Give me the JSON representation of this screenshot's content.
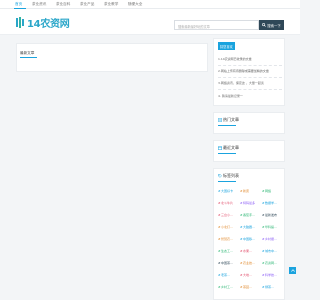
{
  "nav": {
    "items": [
      {
        "label": "首页",
        "active": true
      },
      {
        "label": "茶业资讯",
        "active": false
      },
      {
        "label": "茶业百科",
        "active": false
      },
      {
        "label": "茶业产品",
        "active": false
      },
      {
        "label": "茶业教学",
        "active": false
      },
      {
        "label": "随便大全",
        "active": false
      }
    ]
  },
  "header": {
    "logo_text": "14农资网",
    "search_placeholder": "搜索最新最好玩的文章",
    "search_button": "搜索一下"
  },
  "main": {
    "latest_title": "最新文章"
  },
  "sidebar": {
    "recommend_title": "猜您喜欢",
    "recommend_items": [
      "1.14农资网已收录的文章",
      "2.网站上传有待删除或需要加精的文章",
      "3.网络资讯，保定这 ，大量一起谈",
      "4. 猜请最新记录一"
    ],
    "hot_title": "热门文章",
    "recent_title": "最近文章",
    "tags_title": "标签列表",
    "colors": {
      "accent": "#1aa3de",
      "dark": "#2f4858"
    },
    "tags": [
      {
        "text": "大国好卡",
        "color": "#1aa3de"
      },
      {
        "text": "新唐",
        "color": "#e0892d"
      },
      {
        "text": "网络",
        "color": "#2bb673"
      },
      {
        "text": "北斗牛片",
        "color": "#e14c6a"
      },
      {
        "text": "特码最多",
        "color": "#8b5cf6"
      },
      {
        "text": "数据学…",
        "color": "#1aa3de"
      },
      {
        "text": "三台小…",
        "color": "#e14c6a"
      },
      {
        "text": "番茄手…",
        "color": "#2bb673"
      },
      {
        "text": "最新发布",
        "color": "#2f4858"
      },
      {
        "text": "小北打…",
        "color": "#e0892d"
      },
      {
        "text": "大脑器…",
        "color": "#1aa3de"
      },
      {
        "text": "华科提…",
        "color": "#2bb673"
      },
      {
        "text": "智慧农…",
        "color": "#e0892d"
      },
      {
        "text": "中国移…",
        "color": "#1aa3de"
      },
      {
        "text": "乡村振…",
        "color": "#8b5cf6"
      },
      {
        "text": "生态工…",
        "color": "#2bb673"
      },
      {
        "text": "水果…",
        "color": "#e14c6a"
      },
      {
        "text": "城市中…",
        "color": "#1aa3de"
      },
      {
        "text": "中国茶…",
        "color": "#2f4858"
      },
      {
        "text": "农业技…",
        "color": "#e0892d"
      },
      {
        "text": "农资网…",
        "color": "#2bb673"
      },
      {
        "text": "老茶…",
        "color": "#1aa3de"
      },
      {
        "text": "大地…",
        "color": "#e14c6a"
      },
      {
        "text": "科学技…",
        "color": "#8b5cf6"
      },
      {
        "text": "乡村工…",
        "color": "#2bb673"
      },
      {
        "text": "茶园…",
        "color": "#e0892d"
      },
      {
        "text": "绿茶…",
        "color": "#1aa3de"
      }
    ]
  }
}
